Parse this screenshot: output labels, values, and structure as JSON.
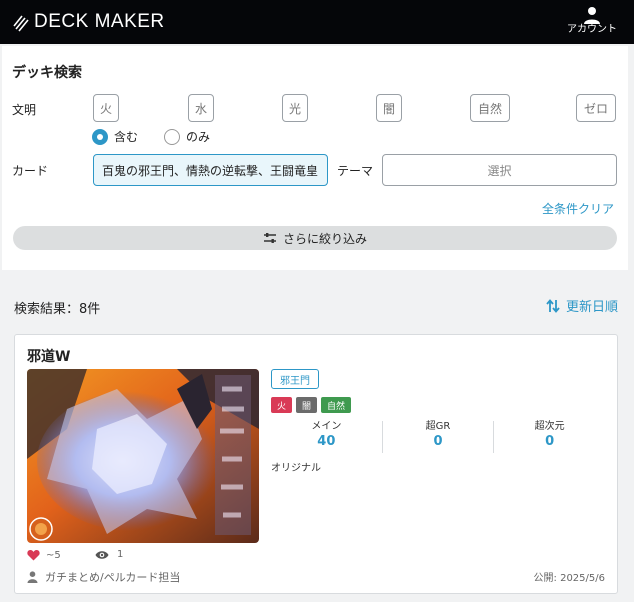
{
  "header": {
    "logo_text": "DECK MAKER",
    "account_label": "アカウント"
  },
  "search": {
    "title": "デッキ検索",
    "civ_label": "文明",
    "civilizations": [
      "火",
      "水",
      "光",
      "闇",
      "自然",
      "ゼロ"
    ],
    "match_options": [
      "含む",
      "のみ"
    ],
    "match_selected": "含む",
    "card_label": "カード",
    "card_value": "百鬼の邪王門、情熱の逆転撃、王闘竜皇",
    "theme_label": "テーマ",
    "theme_placeholder": "選択",
    "clear_label": "全条件クリア",
    "refine_label": "さらに絞り込み"
  },
  "results": {
    "count_label": "検索結果：8件",
    "sort_label": "更新日順"
  },
  "deck": {
    "name": "邪道W",
    "theme_tag": "邪王門",
    "civ_badges": [
      {
        "label": "火",
        "color": "#d93a56"
      },
      {
        "label": "闇",
        "color": "#6b6b6b"
      },
      {
        "label": "自然",
        "color": "#3f9a4f"
      }
    ],
    "stats": [
      {
        "label": "メイン",
        "value": "40"
      },
      {
        "label": "超GR",
        "value": "0"
      },
      {
        "label": "超次元",
        "value": "0"
      }
    ],
    "format": "オリジナル",
    "likes": "~5",
    "views": "1",
    "author": "ガチまとめ/ペルカード担当",
    "published": "公開: 2025/5/6"
  },
  "colors": {
    "accent": "#2d97c7",
    "header_bg": "#050609",
    "like_red": "#d93a56"
  },
  "icons": [
    "deck-maker-logo-icon",
    "account-icon",
    "sliders-icon",
    "sort-icon",
    "heart-icon",
    "eye-icon",
    "user-icon"
  ]
}
